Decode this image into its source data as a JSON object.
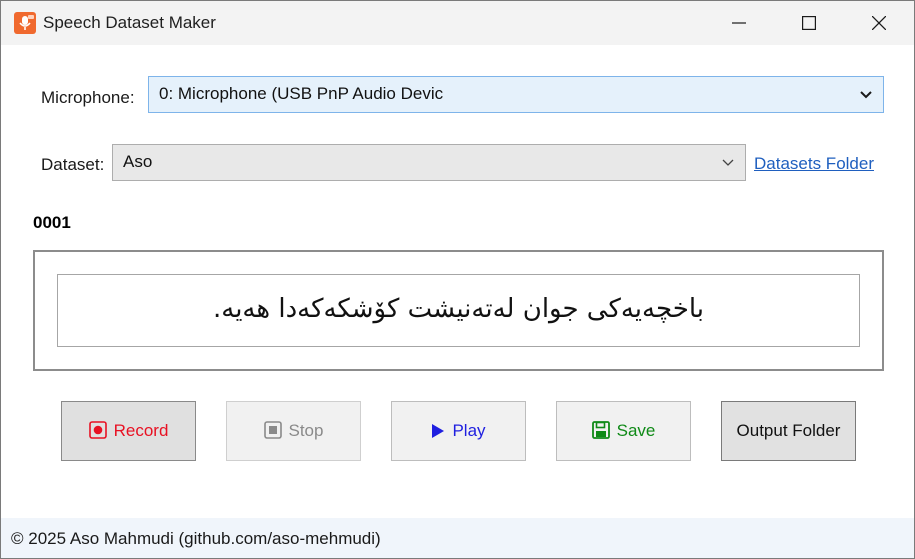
{
  "window": {
    "title": "Speech Dataset Maker",
    "minimize_icon": "minimize-icon",
    "maximize_icon": "maximize-icon",
    "close_icon": "close-icon"
  },
  "microphone": {
    "label": "Microphone:",
    "selected": "0: Microphone (USB PnP Audio Devic"
  },
  "dataset": {
    "label": "Dataset:",
    "selected": "Aso",
    "folder_link": "Datasets Folder"
  },
  "sentence": {
    "number": "0001",
    "text": "باخچەیەکی جوان لەتەنیشت کۆشکەکەدا هەیە."
  },
  "buttons": {
    "record": "Record",
    "stop": "Stop",
    "play": "Play",
    "save": "Save",
    "output_folder": "Output Folder"
  },
  "status": {
    "footer": "© 2025 Aso Mahmudi (github.com/aso-mehmudi)"
  },
  "colors": {
    "accent": "#f0692e",
    "record": "#e81123",
    "play": "#1f1fe0",
    "save": "#0f8a17",
    "link": "#1f5fbf",
    "selected_combo": "#e5f1fb"
  }
}
